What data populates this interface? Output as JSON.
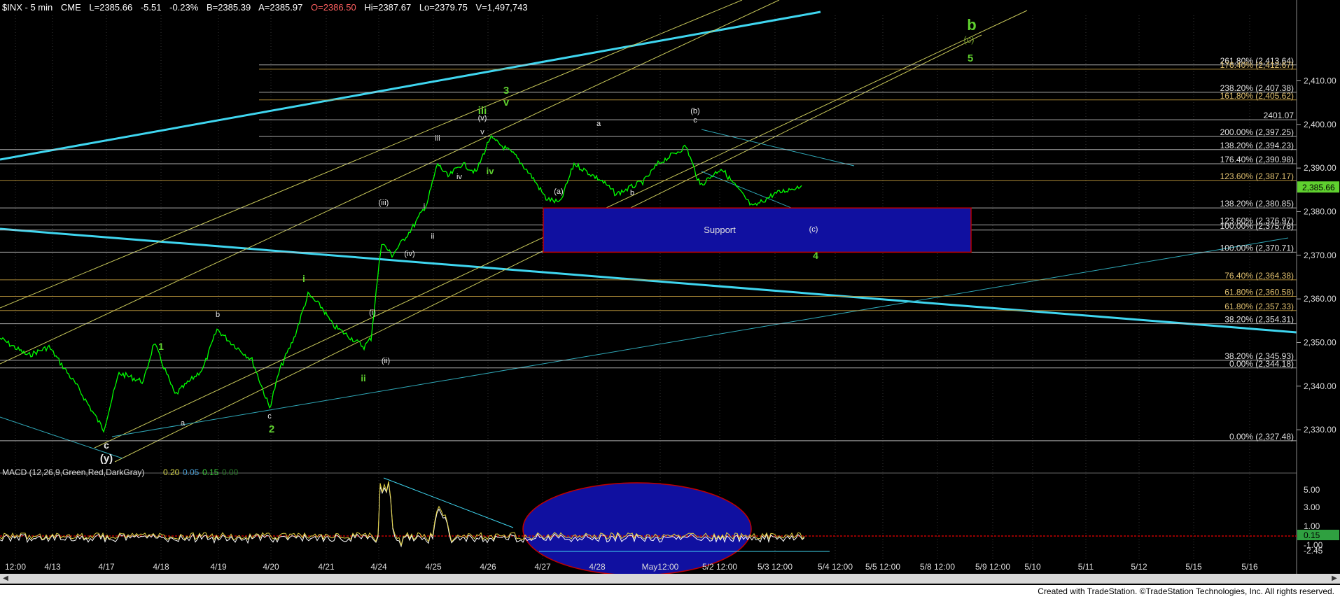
{
  "header": {
    "symbol": "$INX - 5 min",
    "exchange": "CME",
    "last": "L=2385.66",
    "change": "-5.51",
    "change_pct": "-0.23%",
    "bid": "B=2385.39",
    "ask": "A=2385.97",
    "open": "O=2386.50",
    "high": "Hi=2387.67",
    "low": "Lo=2379.75",
    "volume": "V=1,497,743"
  },
  "colors": {
    "background": "#000000",
    "price": "#00ff00",
    "trend_cyan": "#3fd6f0",
    "channel_yellow": "#c8c85a",
    "fib_line": "#c8c8c8",
    "support_box": "#1010a0",
    "support_border": "#c00000",
    "wave_green": "#5fd02f",
    "label_gray": "#d0d0d0"
  },
  "chart_data": {
    "type": "line",
    "title": "$INX - 5 min",
    "price_axis": {
      "range": [
        2322,
        2425
      ],
      "ticks": [
        2330,
        2340,
        2350,
        2360,
        2370,
        2380,
        2390,
        2400,
        2410
      ],
      "tick_labels": [
        "2,330.00",
        "2,340.00",
        "2,350.00",
        "2,360.00",
        "2,370.00",
        "2,380.00",
        "2,390.00",
        "2,400.00",
        "2,410.00"
      ],
      "last_price_label": "2,385.66"
    },
    "time_axis": {
      "tick_labels": [
        "12:00",
        "4/13",
        "4/17",
        "4/18",
        "4/19",
        "4/20",
        "4/21",
        "4/24",
        "4/25",
        "4/26",
        "4/27",
        "4/28",
        "May12:00",
        "5/2 12:00",
        "5/3 12:00",
        "5/4 12:00",
        "5/5 12:00",
        "5/8 12:00",
        "5/9 12:00",
        "5/10",
        "5/11",
        "5/12",
        "5/15",
        "5/16"
      ]
    },
    "series": [
      {
        "name": "$INX",
        "points": [
          [
            "4/13",
            2351
          ],
          [
            "4/13",
            2347
          ],
          [
            "4/13",
            2349
          ],
          [
            "4/17",
            2340
          ],
          [
            "4/17",
            2330
          ],
          [
            "4/17",
            2343
          ],
          [
            "4/18",
            2341
          ],
          [
            "4/18",
            2350
          ],
          [
            "4/18",
            2338
          ],
          [
            "4/19",
            2344
          ],
          [
            "4/19",
            2353
          ],
          [
            "4/19",
            2350
          ],
          [
            "4/20",
            2346
          ],
          [
            "4/20",
            2335
          ],
          [
            "4/20",
            2344
          ],
          [
            "4/20",
            2351
          ],
          [
            "4/21",
            2361
          ],
          [
            "4/21",
            2358
          ],
          [
            "4/21",
            2354
          ],
          [
            "4/24",
            2349
          ],
          [
            "4/24",
            2351
          ],
          [
            "4/24",
            2373
          ],
          [
            "4/24",
            2370
          ],
          [
            "4/25",
            2377
          ],
          [
            "4/25",
            2382
          ],
          [
            "4/25",
            2391
          ],
          [
            "4/25",
            2388
          ],
          [
            "4/26",
            2391
          ],
          [
            "4/26",
            2389
          ],
          [
            "4/26",
            2397
          ],
          [
            "4/26",
            2393
          ],
          [
            "4/27",
            2388
          ],
          [
            "4/27",
            2383
          ],
          [
            "4/27",
            2382
          ],
          [
            "4/28",
            2391
          ],
          [
            "4/28",
            2387
          ],
          [
            "4/28",
            2384
          ],
          [
            "May12:00",
            2387
          ],
          [
            "May12:00",
            2391
          ],
          [
            "May12:00",
            2395
          ],
          [
            "5/2 12:00",
            2386
          ],
          [
            "5/2 12:00",
            2390
          ],
          [
            "5/3 12:00",
            2381
          ],
          [
            "5/3 12:00",
            2384
          ],
          [
            "5/3 12:00",
            2386
          ]
        ]
      }
    ],
    "fib_levels": [
      {
        "label": "261.80% (2,413.64)",
        "value": 2413.64
      },
      {
        "label": "176.40% (2,412.67)",
        "value": 2412.67
      },
      {
        "label": "238.20% (2,407.38)",
        "value": 2407.38
      },
      {
        "label": "161.80% (2,405.62)",
        "value": 2405.62
      },
      {
        "label": "2401.07",
        "value": 2401.07
      },
      {
        "label": "200.00% (2,397.25)",
        "value": 2397.25
      },
      {
        "label": "138.20% (2,394.23)",
        "value": 2394.23
      },
      {
        "label": "176.40% (2,390.98)",
        "value": 2390.98
      },
      {
        "label": "123.60% (2,387.17)",
        "value": 2387.17
      },
      {
        "label": "138.20% (2,380.85)",
        "value": 2380.85
      },
      {
        "label": "123.60% (2,376.97)",
        "value": 2376.97
      },
      {
        "label": "100.00% (2,375.78)",
        "value": 2375.78
      },
      {
        "label": "100.00% (2,370.71)",
        "value": 2370.71
      },
      {
        "label": "76.40% (2,364.38)",
        "value": 2364.38
      },
      {
        "label": "61.80% (2,360.58)",
        "value": 2360.58
      },
      {
        "label": "61.80% (2,357.33)",
        "value": 2357.33
      },
      {
        "label": "38.20% (2,354.31)",
        "value": 2354.31
      },
      {
        "label": "38.20% (2,345.93)",
        "value": 2345.93
      },
      {
        "label": "0.00% (2,344.18)",
        "value": 2344.18
      },
      {
        "label": "0.00% (2,327.48)",
        "value": 2327.48
      }
    ],
    "support_box": {
      "label": "Support",
      "top": 2380.85,
      "bottom": 2370.71
    },
    "wave_labels": [
      {
        "text": "(y)"
      },
      {
        "text": "c"
      },
      {
        "text": "a"
      },
      {
        "text": "1"
      },
      {
        "text": "b"
      },
      {
        "text": "c"
      },
      {
        "text": "2"
      },
      {
        "text": "i"
      },
      {
        "text": "(i)"
      },
      {
        "text": "(ii)"
      },
      {
        "text": "ii"
      },
      {
        "text": "(iii)"
      },
      {
        "text": "(iv)"
      },
      {
        "text": "i"
      },
      {
        "text": "ii"
      },
      {
        "text": "iii"
      },
      {
        "text": "iv"
      },
      {
        "text": "(v)"
      },
      {
        "text": "v"
      },
      {
        "text": "iv"
      },
      {
        "text": "iii"
      },
      {
        "text": "v"
      },
      {
        "text": "3"
      },
      {
        "text": "(a)"
      },
      {
        "text": "a"
      },
      {
        "text": "b"
      },
      {
        "text": "(b)"
      },
      {
        "text": "c"
      },
      {
        "text": "(c)"
      },
      {
        "text": "4"
      },
      {
        "text": "b"
      },
      {
        "text": "(c)"
      },
      {
        "text": "5"
      }
    ],
    "macd": {
      "label": "MACD (12,26,9,Green,Red,DarkGray)",
      "values": [
        "0.20",
        "0.05",
        "0.15",
        "0.00"
      ],
      "axis_ticks": [
        "5.00",
        "3.00",
        "1.00",
        "0.15",
        "-1.00",
        "-2.45"
      ]
    }
  },
  "footer": {
    "text": "Created with TradeStation. ©TradeStation Technologies, Inc. All rights reserved."
  }
}
